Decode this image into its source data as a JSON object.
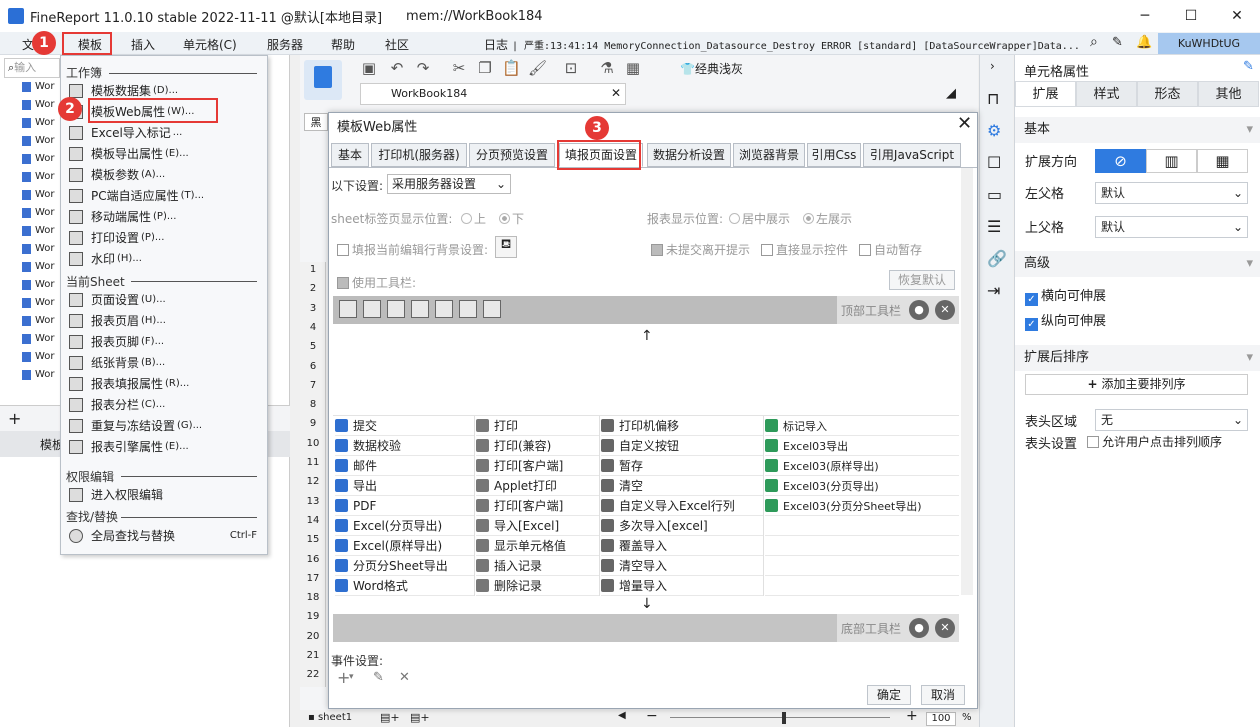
{
  "app": {
    "title": "FineReport 11.0.10 stable 2022-11-11 @默认[本地目录]",
    "path": "mem://WorkBook184",
    "minimize": "─",
    "maximize": "☐",
    "close": "✕"
  },
  "menubar": {
    "items": [
      "文",
      "模板",
      "插入",
      "单元格(C)",
      "服务器",
      "帮助",
      "社区"
    ],
    "log_label": "日志",
    "log_text": "| 严重:13:41:14 MemoryConnection_Datasource_Destroy ERROR [standard] [DataSourceWrapper]Data...",
    "user": "KuWHDtUG",
    "annotations": [
      "1",
      "2",
      "3"
    ]
  },
  "left": {
    "search_placeholder": "输入",
    "tree_item": "Wor",
    "bottom_label": "模板",
    "add": "+"
  },
  "menu": {
    "sections": [
      "工作簿",
      "当前Sheet",
      "权限编辑",
      "查找/替换"
    ],
    "workbook_items": [
      {
        "label": "模板数据集",
        "sc": "(D)..."
      },
      {
        "label": "模板Web属性",
        "sc": "(W)..."
      },
      {
        "label": "Excel导入标记",
        "sc": "..."
      },
      {
        "label": "模板导出属性",
        "sc": "(E)..."
      },
      {
        "label": "模板参数",
        "sc": "(A)..."
      },
      {
        "label": "PC端自适应属性",
        "sc": "(T)..."
      },
      {
        "label": "移动端属性",
        "sc": "(P)..."
      },
      {
        "label": "打印设置",
        "sc": "(P)..."
      },
      {
        "label": "水印",
        "sc": "(H)..."
      }
    ],
    "sheet_items": [
      {
        "label": "页面设置",
        "sc": "(U)..."
      },
      {
        "label": "报表页眉",
        "sc": "(H)..."
      },
      {
        "label": "报表页脚",
        "sc": "(F)..."
      },
      {
        "label": "纸张背景",
        "sc": "(B)..."
      },
      {
        "label": "报表填报属性",
        "sc": "(R)..."
      },
      {
        "label": "报表分栏",
        "sc": "(C)..."
      },
      {
        "label": "重复与冻结设置",
        "sc": "(G)..."
      },
      {
        "label": "报表引擎属性",
        "sc": "(E)..."
      }
    ],
    "perm_item": "进入权限编辑",
    "find_item": "全局查找与替换",
    "find_sc": "Ctrl-F"
  },
  "mid": {
    "doc_tab": "WorkBook184",
    "toolbar_style": "经典浅灰",
    "sheet": "sheet1",
    "zoom": "100",
    "pct": "%",
    "rows": [
      "1",
      "2",
      "3",
      "4",
      "5",
      "6",
      "7",
      "8",
      "9",
      "10",
      "11",
      "12",
      "13",
      "14",
      "15",
      "16",
      "17",
      "18",
      "19",
      "20",
      "21",
      "22"
    ],
    "col_letter": "黑"
  },
  "dialog": {
    "title": "模板Web属性",
    "tabs": [
      "基本",
      "打印机(服务器)",
      "分页预览设置",
      "填报页面设置",
      "数据分析设置",
      "浏览器背景",
      "引用Css",
      "引用JavaScript"
    ],
    "settings_label": "以下设置:",
    "settings_value": "采用服务器设置",
    "sheet_pos_label": "sheet标签页显示位置:",
    "pos_top": "上",
    "pos_bottom": "下",
    "report_pos_label": "报表显示位置:",
    "center": "居中展示",
    "left": "左展示",
    "fill_bg": "填报当前编辑行背景设置:",
    "unsubmit": "未提交离开提示",
    "direct_show": "直接显示控件",
    "autosave": "自动暂存",
    "use_toolbar": "使用工具栏:",
    "restore": "恢复默认",
    "top_toolbar": "顶部工具栏",
    "bottom_toolbar": "底部工具栏",
    "up_arrow": "↑",
    "down_arrow": "↓",
    "grid": [
      [
        "提交",
        "打印",
        "打印机偏移",
        "标记导入"
      ],
      [
        "数据校验",
        "打印(兼容)",
        "自定义按钮",
        "Excel03导出"
      ],
      [
        "邮件",
        "打印[客户端]",
        "暂存",
        "Excel03(原样导出)"
      ],
      [
        "导出",
        "Applet打印",
        "清空",
        "Excel03(分页导出)"
      ],
      [
        "PDF",
        "打印[客户端]",
        "自定义导入Excel行列",
        "Excel03(分页分Sheet导出)"
      ],
      [
        "Excel(分页导出)",
        "导入[Excel]",
        "多次导入[excel]",
        ""
      ],
      [
        "Excel(原样导出)",
        "显示单元格值",
        "覆盖导入",
        ""
      ],
      [
        "分页分Sheet导出",
        "插入记录",
        "清空导入",
        ""
      ],
      [
        "Word格式",
        "删除记录",
        "增量导入",
        ""
      ]
    ],
    "event_label": "事件设置:",
    "ok": "确定",
    "cancel": "取消"
  },
  "right": {
    "title": "单元格属性",
    "tabs": [
      "扩展",
      "样式",
      "形态",
      "其他"
    ],
    "basic": "基本",
    "expand_dir": "扩展方向",
    "left_parent": "左父格",
    "left_parent_val": "默认",
    "up_parent": "上父格",
    "up_parent_val": "默认",
    "advanced": "高级",
    "h_expand": "横向可伸展",
    "v_expand": "纵向可伸展",
    "sort_hdr": "扩展后排序",
    "add_sort": "添加主要排列序",
    "header_area": "表头区域",
    "header_area_val": "无",
    "header_setting": "表头设置",
    "allow_sort": "允许用户点击排列顺序"
  },
  "colors": {
    "accent": "#2f7be0",
    "red": "#e53935",
    "user_bg": "#a6c8ef"
  }
}
